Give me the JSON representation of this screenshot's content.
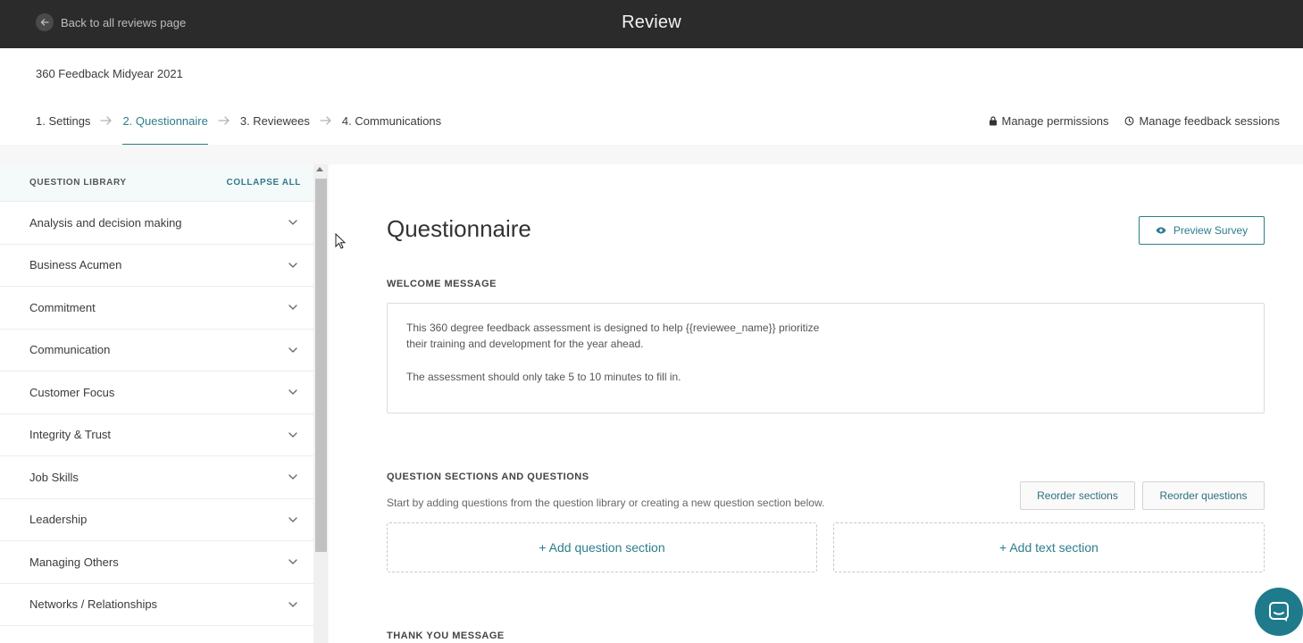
{
  "topbar": {
    "back_label": "Back to all reviews page",
    "title": "Review"
  },
  "subheader": {
    "review_name": "360 Feedback Midyear 2021",
    "steps": [
      {
        "label": "1. Settings",
        "active": false
      },
      {
        "label": "2. Questionnaire",
        "active": true
      },
      {
        "label": "3. Reviewees",
        "active": false
      },
      {
        "label": "4. Communications",
        "active": false
      }
    ],
    "manage_permissions": "Manage permissions",
    "manage_sessions": "Manage feedback sessions"
  },
  "library": {
    "title": "QUESTION LIBRARY",
    "collapse_all": "COLLAPSE ALL",
    "items": [
      {
        "label": "Analysis and decision making"
      },
      {
        "label": "Business Acumen"
      },
      {
        "label": "Commitment"
      },
      {
        "label": "Communication"
      },
      {
        "label": "Customer Focus"
      },
      {
        "label": "Integrity & Trust"
      },
      {
        "label": "Job Skills"
      },
      {
        "label": "Leadership"
      },
      {
        "label": "Managing Others"
      },
      {
        "label": "Networks / Relationships"
      }
    ]
  },
  "main": {
    "title": "Questionnaire",
    "preview_button": "Preview Survey",
    "welcome_label": "WELCOME MESSAGE",
    "welcome_line1": "This 360 degree feedback assessment is designed to help {{reviewee_name}} prioritize",
    "welcome_line2": "their training and development for the year ahead.",
    "welcome_line3": "The assessment should only take 5 to 10 minutes to fill in.",
    "sections_label": "QUESTION SECTIONS AND QUESTIONS",
    "sections_helper": "Start by adding questions from the question library or creating a new question section below.",
    "reorder_sections": "Reorder sections",
    "reorder_questions": "Reorder questions",
    "add_question_section": "+ Add question section",
    "add_text_section": "+ Add text section",
    "thank_you_label": "THANK YOU MESSAGE"
  },
  "colors": {
    "accent": "#2e7d8c",
    "topbar": "#2b2b2b",
    "chat": "#1f7a8c"
  },
  "icons": {
    "back": "arrow-left-icon",
    "step_separator": "arrow-right-icon",
    "permissions": "lock-icon",
    "sessions": "clock-icon",
    "expand": "chevron-down-icon",
    "preview": "eye-icon",
    "chat": "chat-icon"
  }
}
